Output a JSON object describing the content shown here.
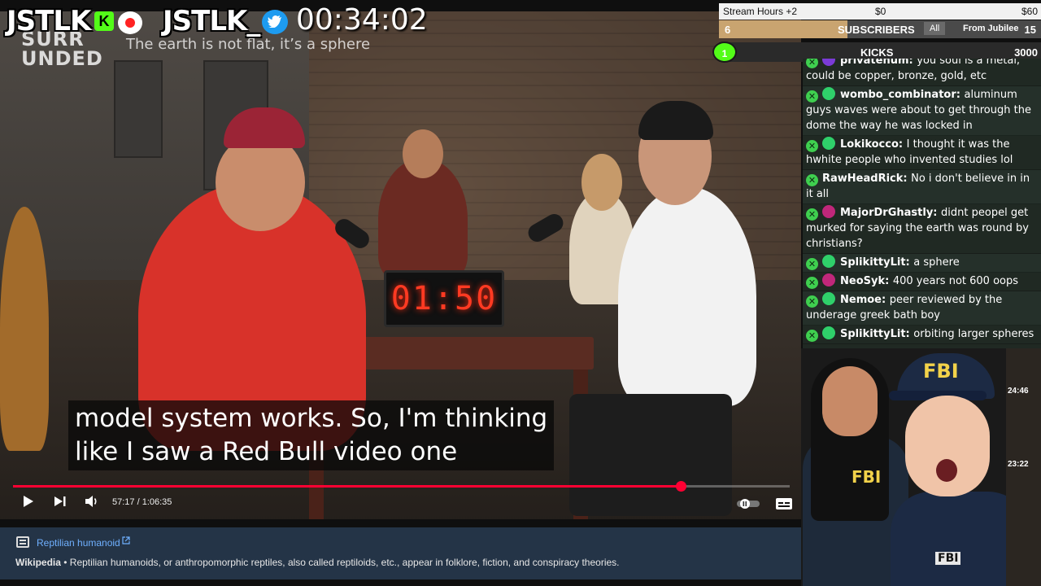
{
  "overlay": {
    "brand_left": "JSTLK",
    "brand_right": "JSTLK_",
    "stream_clock": "00:34:02"
  },
  "video": {
    "logo_line1": "SURR",
    "logo_line2": "UNDED",
    "caption_top": "The earth is not flat, it’s a sphere",
    "clock_display": "01:50",
    "subtitle_line1": "model system works. So, I'm thinking",
    "subtitle_line2": "like I saw a Red Bull video one",
    "time_current": "57:17",
    "time_separator": "/",
    "time_total": "1:06:35",
    "progress_fraction": 0.86
  },
  "stats": {
    "stream_hours": "Stream Hours +2",
    "money_min": "$0",
    "money_max": "$60",
    "subs_count": "6",
    "subs_label": "SUBSCRIBERS",
    "subs_filter": "All",
    "subs_source": "From Jubilee",
    "subs_source_count": "15",
    "subs_progress": 0.4,
    "kicks_badge": "1",
    "kicks_label": "KICKS",
    "kicks_goal": "3000"
  },
  "chat": {
    "messages": [
      {
        "user": "privatenum",
        "text": "you soul is a metal, could be copper, bronze, gold, etc",
        "badge_color": "#7a3bd6"
      },
      {
        "user": "wombo_combinator",
        "text": "aluminum guys waves were about to get through the dome the way he was locked in",
        "badge_color": "#2fd06a"
      },
      {
        "user": "Lokikocco",
        "text": "I thought it was the hwhite people who invented studies lol",
        "badge_color": "#2fd06a"
      },
      {
        "user": "RawHeadRick",
        "text": "No i don't believe in in it all",
        "badge_color": ""
      },
      {
        "user": "MajorDrGhastly",
        "text": "didnt peopel get murked for saying the earth was round by christians?",
        "badge_color": "#c0277a"
      },
      {
        "user": "SplikittyLit",
        "text": "a sphere",
        "badge_color": "#2fd06a"
      },
      {
        "user": "NeoSyk",
        "text": "400 years not 600 oops",
        "badge_color": "#c0277a"
      },
      {
        "user": "Nemoe",
        "text": "peer reviewed by the underage greek bath boy",
        "badge_color": "#2fd06a"
      },
      {
        "user": "SplikittyLit",
        "text": "orbiting larger spheres",
        "badge_color": "#2fd06a"
      }
    ]
  },
  "avatars": {
    "fbi_cap": "FBI",
    "fbi_woman": "FBI",
    "fbi_man": "FBI",
    "thumb_time_1": "24:46",
    "thumb_time_2": "23:22"
  },
  "infocard": {
    "title": "Reptilian humanoid",
    "source": "Wikipedia",
    "bullet": "•",
    "description": "Reptilian humanoids, or anthropomorphic reptiles, also called reptiloids, etc., appear in folklore, fiction, and conspiracy theories."
  },
  "icons": {
    "play": "play-icon",
    "next": "skip-next-icon",
    "volume": "volume-icon",
    "captions": "captions-icon",
    "autoplay": "autoplay-toggle-icon",
    "external": "external-link-icon",
    "doc": "document-icon"
  }
}
